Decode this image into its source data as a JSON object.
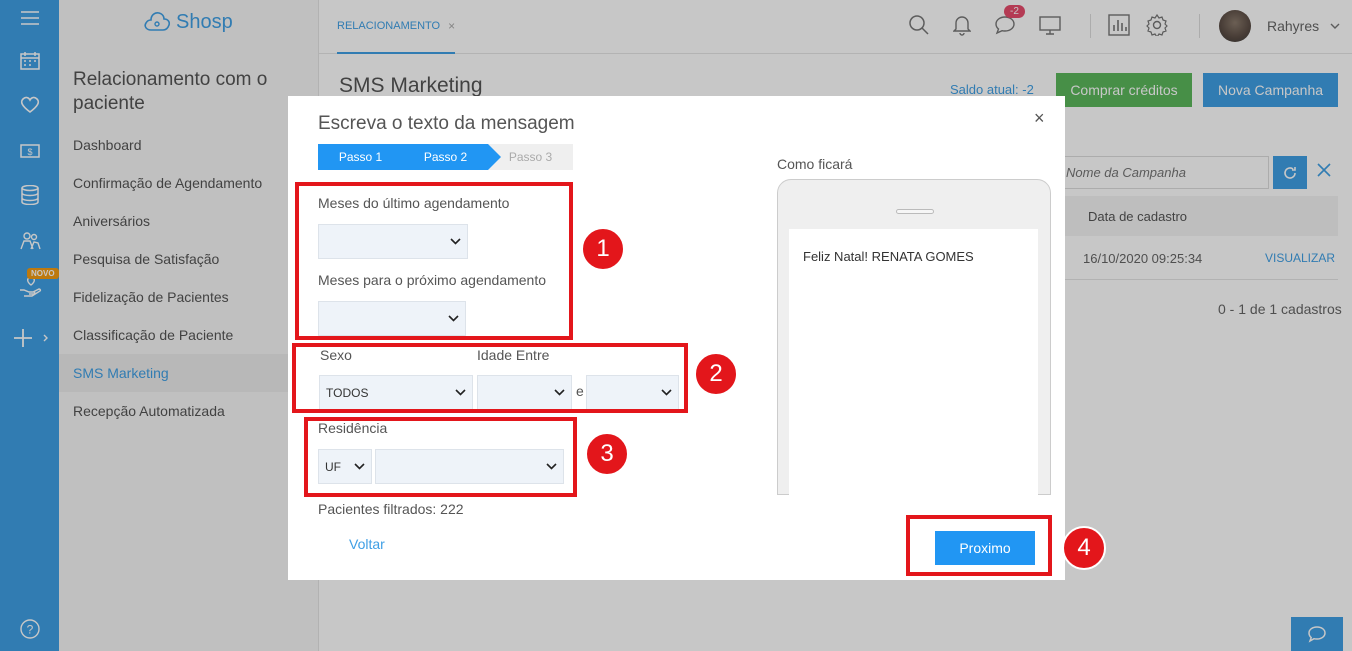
{
  "app": {
    "logo_text": "Shosp",
    "brand_color": "#3f9fe5"
  },
  "rail": {
    "icons": [
      "menu-icon",
      "calendar-icon",
      "heart-icon",
      "money-icon",
      "database-icon",
      "people-icon",
      "hand-heart-icon",
      "plus-icon",
      "help-icon"
    ],
    "novo_badge": "NOVO"
  },
  "sidebar": {
    "title": "Relacionamento com o paciente",
    "items": [
      {
        "label": "Dashboard"
      },
      {
        "label": "Confirmação de Agendamento"
      },
      {
        "label": "Aniversários"
      },
      {
        "label": "Pesquisa de Satisfação"
      },
      {
        "label": "Fidelização de Pacientes"
      },
      {
        "label": "Classificação de Paciente"
      },
      {
        "label": "SMS Marketing"
      },
      {
        "label": "Recepção Automatizada"
      }
    ],
    "active_item": "SMS Marketing"
  },
  "topbar": {
    "tab_label": "RELACIONAMENTO",
    "tab_close": "×",
    "notification_count": "-2",
    "username": "Rahyres"
  },
  "main": {
    "title": "SMS Marketing",
    "saldo": "Saldo atual: -2",
    "buy_credits": "Comprar créditos",
    "new_campaign": "Nova Campanha",
    "search_placeholder": "Nome da Campanha",
    "col_date": "Data de cadastro",
    "row_date": "16/10/2020 09:25:34",
    "row_action": "VISUALIZAR",
    "pagination": "0 - 1 de 1 cadastros"
  },
  "modal": {
    "title": "Escreva o texto da mensagem",
    "close": "×",
    "steps": [
      "Passo 1",
      "Passo 2",
      "Passo 3"
    ],
    "label_last_months": "Meses do último agendamento",
    "label_next_months": "Meses para o próximo agendamento",
    "label_sexo": "Sexo",
    "label_idade": "Idade Entre",
    "sexo_value": "TODOS",
    "idade_e": "e",
    "label_residencia": "Residência",
    "uf_value": "UF",
    "pacientes_label": "Pacientes filtrados: ",
    "pacientes_count": "222",
    "voltar": "Voltar",
    "preview_label": "Como ficará",
    "preview_message": "Feliz Natal! RENATA GOMES",
    "next": "Proximo"
  },
  "annotations": [
    "1",
    "2",
    "3",
    "4"
  ],
  "colors": {
    "annotation": "#e3161b",
    "primary": "#2196f3",
    "success": "#5cb85c"
  }
}
